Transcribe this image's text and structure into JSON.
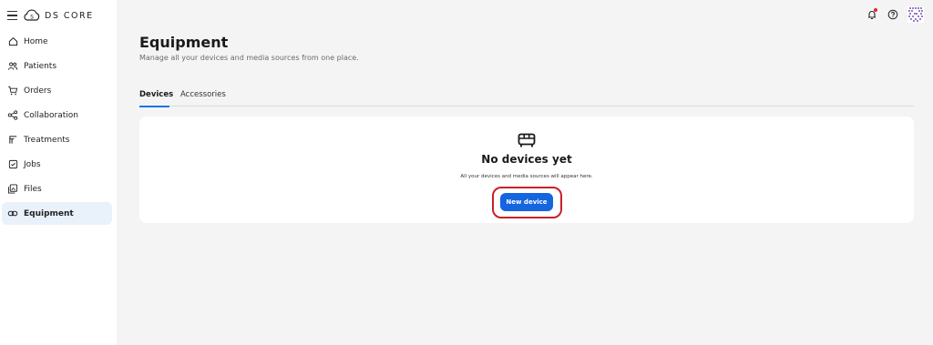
{
  "app": {
    "brand_text": "DS CORE"
  },
  "sidebar": {
    "items": [
      {
        "label": "Home",
        "icon": "home-icon"
      },
      {
        "label": "Patients",
        "icon": "patients-icon"
      },
      {
        "label": "Orders",
        "icon": "cart-icon"
      },
      {
        "label": "Collaboration",
        "icon": "share-icon"
      },
      {
        "label": "Treatments",
        "icon": "treatments-icon"
      },
      {
        "label": "Jobs",
        "icon": "jobs-icon"
      },
      {
        "label": "Files",
        "icon": "files-icon"
      },
      {
        "label": "Equipment",
        "icon": "equipment-icon",
        "active": true
      }
    ]
  },
  "header": {
    "title": "Equipment",
    "subtitle": "Manage all your devices and media sources from one place."
  },
  "tabs": [
    {
      "label": "Devices",
      "active": true
    },
    {
      "label": "Accessories",
      "active": false
    }
  ],
  "empty_state": {
    "icon": "device-icon",
    "title": "No devices yet",
    "description": "All your devices and media sources will appear here.",
    "button_label": "New device"
  },
  "colors": {
    "accent": "#1565e0",
    "active_nav_bg": "#e9f1fb",
    "highlight_border": "#c8202b",
    "notification_dot": "#e3262e"
  }
}
